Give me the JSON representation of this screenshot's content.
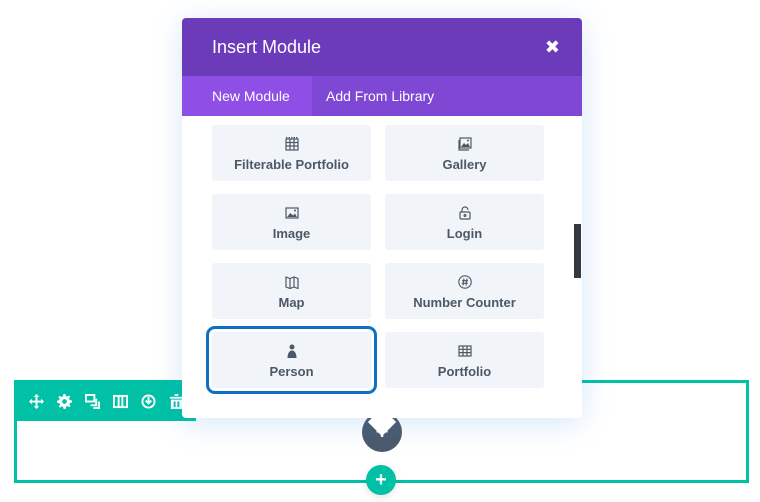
{
  "modal": {
    "title": "Insert Module",
    "close_icon": "close-icon",
    "tabs": [
      {
        "label": "New Module",
        "active": true
      },
      {
        "label": "Add From Library",
        "active": false
      }
    ],
    "modules": [
      {
        "label": "Filterable Portfolio",
        "icon": "grid-icon",
        "selected": false
      },
      {
        "label": "Gallery",
        "icon": "gallery-icon",
        "selected": false
      },
      {
        "label": "Image",
        "icon": "image-icon",
        "selected": false
      },
      {
        "label": "Login",
        "icon": "lock-icon",
        "selected": false
      },
      {
        "label": "Map",
        "icon": "map-icon",
        "selected": false
      },
      {
        "label": "Number Counter",
        "icon": "hash-icon",
        "selected": false
      },
      {
        "label": "Person",
        "icon": "person-icon",
        "selected": true
      },
      {
        "label": "Portfolio",
        "icon": "grid-icon",
        "selected": false
      }
    ]
  },
  "section_toolbar": {
    "icons": [
      "move-icon",
      "gear-icon",
      "duplicate-icon",
      "columns-icon",
      "save-icon",
      "trash-icon"
    ]
  },
  "buttons": {
    "add_module": "+",
    "add_row": "+"
  },
  "colors": {
    "header": "#6c3bb9",
    "tabs": "#7e48d4",
    "active_tab": "#8f4fe6",
    "section": "#00c1a6",
    "selected_outline": "#0c71c3",
    "add_module_button": "#4b5a6b"
  }
}
